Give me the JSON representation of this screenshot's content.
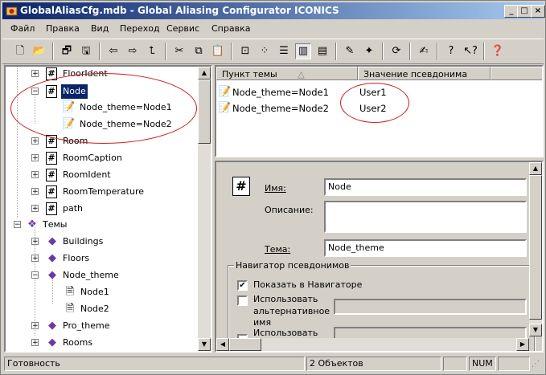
{
  "window": {
    "title": "GlobalAliasCfg.mdb - Global Aliasing Configurator  ICONICS",
    "min_label": "_",
    "max_label": "□",
    "close_label": "×"
  },
  "menu": [
    "Файл",
    "Правка",
    "Вид",
    "Переход",
    "Сервис",
    "Справка"
  ],
  "toolbar_icons": [
    "new-icon",
    "open-icon",
    "properties-icon",
    "save-icon",
    "back-icon",
    "forward-icon",
    "up-folder-icon",
    "cut-icon",
    "copy-icon",
    "paste-icon",
    "large-icons-icon",
    "small-icons-icon",
    "list-view-icon",
    "details-view-icon",
    "report-view-icon",
    "alias-icon",
    "theme-icon",
    "refresh-icon",
    "edit-icon",
    "help-icon",
    "whats-this-icon",
    "about-icon"
  ],
  "tree": {
    "items": [
      {
        "label": "FloorIdent",
        "expander": "+",
        "icon": "#"
      },
      {
        "label": "Node",
        "expander": "−",
        "icon": "#",
        "selected": true
      },
      {
        "label": "Node_theme=Node1",
        "expander": "",
        "icon": "alias"
      },
      {
        "label": "Node_theme=Node2",
        "expander": "",
        "icon": "alias"
      },
      {
        "label": "Room",
        "expander": "+",
        "icon": "#"
      },
      {
        "label": "RoomCaption",
        "expander": "+",
        "icon": "#"
      },
      {
        "label": "RoomIdent",
        "expander": "+",
        "icon": "#"
      },
      {
        "label": "RoomTemperature",
        "expander": "+",
        "icon": "#"
      },
      {
        "label": "path",
        "expander": "+",
        "icon": "#"
      },
      {
        "label": "Темы",
        "expander": "−",
        "icon": "themes"
      },
      {
        "label": "Buildings",
        "expander": "+",
        "icon": "book"
      },
      {
        "label": "Floors",
        "expander": "+",
        "icon": "book"
      },
      {
        "label": "Node_theme",
        "expander": "−",
        "icon": "book"
      },
      {
        "label": "Node1",
        "expander": "",
        "icon": "doc"
      },
      {
        "label": "Node2",
        "expander": "",
        "icon": "doc"
      },
      {
        "label": "Pro_theme",
        "expander": "+",
        "icon": "book"
      },
      {
        "label": "Rooms",
        "expander": "+",
        "icon": "book"
      }
    ]
  },
  "list": {
    "columns": [
      "Пункт темы",
      "Значение псевдонима"
    ],
    "sort_indicator": "△",
    "rows": [
      {
        "item": "Node_theme=Node1",
        "value": "User1"
      },
      {
        "item": "Node_theme=Node2",
        "value": "User2"
      }
    ]
  },
  "properties": {
    "name_label": "Имя:",
    "name_value": "Node",
    "description_label": "Описание:",
    "description_value": "",
    "theme_label": "Тема:",
    "theme_value": "Node_theme",
    "navigator_group": "Навигатор псевдонимов",
    "show_in_navigator": "Показать в Навигаторе",
    "show_in_navigator_checked": true,
    "use_alt_name_line1": "Использовать",
    "use_alt_name_line2": "альтернативное",
    "use_alt_name_line3": "имя",
    "use_alt_name_checked": false,
    "use_next_partial": "Использовать"
  },
  "status": {
    "ready": "Готовность",
    "objects": "2 Объектов",
    "num": "NUM"
  },
  "colors": {
    "title_start": "#0a246a",
    "title_end": "#a6caf0",
    "annotation": "#d01c1c",
    "selection": "#0a246a"
  }
}
